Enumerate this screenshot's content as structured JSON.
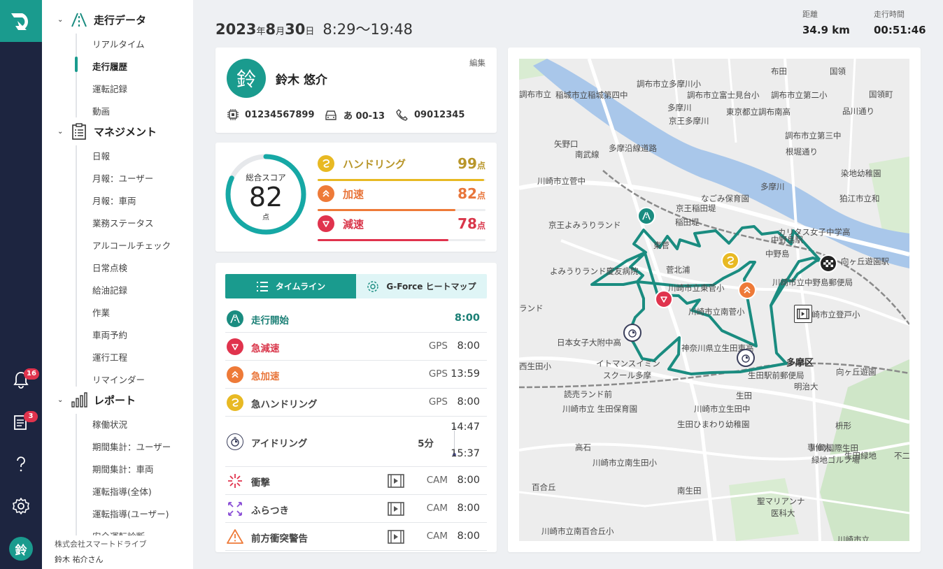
{
  "nav": {
    "sections": [
      {
        "title": "走行データ",
        "items": [
          "リアルタイム",
          "走行履歴",
          "運転記録",
          "動画"
        ]
      },
      {
        "title": "マネジメント",
        "items": [
          "日報",
          "月報：ユーザー",
          "月報：車両",
          "業務ステータス",
          "アルコールチェック",
          "日常点検",
          "給油記録",
          "作業",
          "車両予約",
          "運行工程",
          "リマインダー"
        ]
      },
      {
        "title": "レポート",
        "items": [
          "稼働状況",
          "期間集計：ユーザー",
          "期間集計：車両",
          "運転指導(全体)",
          "運転指導(ユーザー)",
          "安全運転診断"
        ]
      }
    ],
    "active_item": "走行履歴",
    "footer": {
      "company": "株式会社スマートドライブ",
      "user": "鈴木 祐介さん"
    }
  },
  "rail": {
    "notifications_badge": "16",
    "reports_badge": "3",
    "avatar": "鈴"
  },
  "header": {
    "year": "2023",
    "year_unit": "年",
    "month": "8",
    "month_unit": "月",
    "day": "30",
    "day_unit": "日",
    "time_range": "8:29〜19:48",
    "distance_label": "距離",
    "distance_value": "34.9 km",
    "duration_label": "走行時間",
    "duration_value": "00:51:46"
  },
  "driver": {
    "avatar": "鈴",
    "name": "鈴木 悠介",
    "edit_label": "編集",
    "device_id": "01234567899",
    "plate": "あ 00-13",
    "phone": "09012345"
  },
  "score": {
    "label": "総合スコア",
    "value": "82",
    "unit": "点",
    "fraction": 0.82,
    "items": [
      {
        "name": "ハンドリング",
        "score": "99",
        "unit": "点",
        "fraction": 0.99,
        "color": "#e8b923",
        "text_color": "#b8962a"
      },
      {
        "name": "加速",
        "score": "82",
        "unit": "点",
        "fraction": 0.82,
        "color": "#ee7a38",
        "text_color": "#e8753a"
      },
      {
        "name": "減速",
        "score": "78",
        "unit": "点",
        "fraction": 0.78,
        "color": "#e0334d",
        "text_color": "#d9364a"
      }
    ]
  },
  "tabs": {
    "timeline": "タイムライン",
    "heatmap": "G-Force ヒートマップ"
  },
  "timeline": [
    {
      "name": "走行開始",
      "source": "",
      "time": "8:00"
    },
    {
      "name": "急減速",
      "source": "GPS",
      "time": "8:00"
    },
    {
      "name": "急加速",
      "source": "GPS",
      "time": "13:59"
    },
    {
      "name": "急ハンドリング",
      "source": "GPS",
      "time": "8:00"
    },
    {
      "name": "アイドリング",
      "duration": "5分",
      "time_start": "14:47",
      "time_end": "15:37"
    },
    {
      "name": "衝撃",
      "source": "CAM",
      "time": "8:00"
    },
    {
      "name": "ふらつき",
      "source": "CAM",
      "time": "8:00"
    },
    {
      "name": "前方衝突警告",
      "source": "CAM",
      "time": "8:00"
    }
  ],
  "map": {
    "labels": [
      "布田",
      "国領",
      "調布市立多摩川小",
      "稲城市立稲城第四中",
      "調布市立富士見台小",
      "調布市立第二小",
      "矢野口",
      "調布市立",
      "多摩川",
      "京王多摩川",
      "東京都立調布南高",
      "品川通り",
      "国領町",
      "多摩沿線道路",
      "調布市立第三中",
      "根堀通り",
      "南武線",
      "染地幼稚園",
      "狛江市立和",
      "川崎市立菅中",
      "多摩川",
      "なごみ保育園",
      "京王稲田堤",
      "京王よみうりランド",
      "稲田堤",
      "カリタス女子中学高",
      "東菅",
      "中野島",
      "菅北浦",
      "よみうりランド慶友病院",
      "川崎市立中野島郵便局",
      "川崎市立東菅小",
      "ランド",
      "川崎市立南菅小",
      "川崎市立登戸小",
      "日本女子大附中高",
      "神奈川県立生田東高",
      "多摩区",
      "西生田小",
      "イトマンスイミン",
      "スクール多摩",
      "生田駅前郵便局",
      "向ヶ丘遊園",
      "明治大",
      "読売ランド前",
      "生田",
      "川崎市立 生田保育園",
      "川崎市立生田中",
      "枡形",
      "生田ひまわり幼稚園",
      "専修大",
      "不二",
      "高石",
      "川崎国際生田",
      "緑地ゴルフ場",
      "生田緑地",
      "川崎市立南生田小",
      "百合丘",
      "南生田",
      "聖マリアンナ",
      "医科大",
      "川崎市立南百合丘小",
      "川崎市立",
      "中野島駅",
      "向ヶ丘遊園駅"
    ],
    "route_color": "#1a8c80"
  }
}
